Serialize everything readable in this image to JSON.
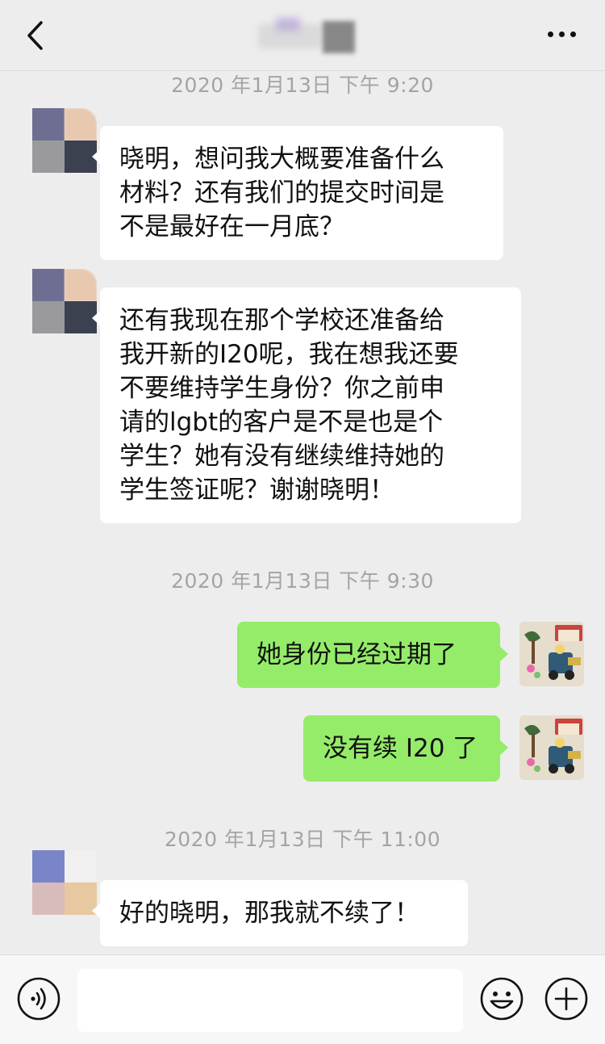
{
  "header": {
    "back_icon": "chevron-left-icon",
    "title": "",
    "more_icon": "ellipsis-icon"
  },
  "messages": [
    {
      "type": "timestamp",
      "text": "2020 年1月13日 下午 9:20"
    },
    {
      "type": "incoming",
      "text": "晓明，想问我大概要准备什么\n材料？还有我们的提交时间是\n不是最好在一月底？"
    },
    {
      "type": "incoming",
      "text": "还有我现在那个学校还准备给\n我开新的I20呢，我在想我还要\n不要维持学生身份？你之前申\n请的lgbt的客户是不是也是个\n学生？她有没有继续维持她的\n学生签证呢？谢谢晓明！"
    },
    {
      "type": "timestamp",
      "text": "2020 年1月13日 下午 9:30"
    },
    {
      "type": "outgoing",
      "text": "她身份已经过期了"
    },
    {
      "type": "outgoing",
      "text": "没有续 I20 了"
    },
    {
      "type": "timestamp",
      "text": "2020 年1月13日 下午 11:00"
    },
    {
      "type": "incoming",
      "text": "好的晓明，那我就不续了！"
    }
  ],
  "input_bar": {
    "voice_icon": "voice-icon",
    "input_value": "",
    "emoji_icon": "emoji-icon",
    "plus_icon": "plus-icon"
  },
  "colors": {
    "background": "#ededed",
    "incoming_bubble": "#ffffff",
    "outgoing_bubble": "#95ec69",
    "timestamp_text": "#a4a4a4"
  }
}
